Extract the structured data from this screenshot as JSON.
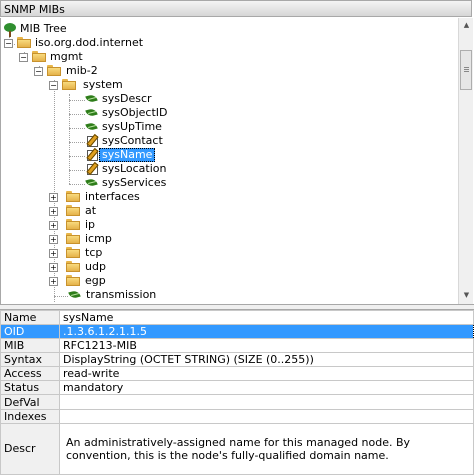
{
  "window": {
    "title": "SNMP MIBs"
  },
  "tree": {
    "root": "MIB Tree",
    "iso": "iso.org.dod.internet",
    "mgmt": "mgmt",
    "mib2": "mib-2",
    "system": "system",
    "system_children": [
      {
        "label": "sysDescr",
        "icon": "leaf-icon"
      },
      {
        "label": "sysObjectID",
        "icon": "leaf-icon"
      },
      {
        "label": "sysUpTime",
        "icon": "leaf-icon"
      },
      {
        "label": "sysContact",
        "icon": "writable-icon"
      },
      {
        "label": "sysName",
        "icon": "writable-icon",
        "selected": true
      },
      {
        "label": "sysLocation",
        "icon": "writable-icon"
      },
      {
        "label": "sysServices",
        "icon": "leaf-icon"
      }
    ],
    "mib2_folders": [
      "interfaces",
      "at",
      "ip",
      "icmp",
      "tcp",
      "udp",
      "egp"
    ],
    "transmission": "transmission"
  },
  "properties": {
    "header": {
      "name": "Name",
      "value": "sysName"
    },
    "rows": [
      {
        "key": "OID",
        "value": ".1.3.6.1.2.1.1.5",
        "selected": true
      },
      {
        "key": "MIB",
        "value": "RFC1213-MIB"
      },
      {
        "key": "Syntax",
        "value": "DisplayString (OCTET STRING) (SIZE (0..255))"
      },
      {
        "key": "Access",
        "value": "read-write"
      },
      {
        "key": "Status",
        "value": "mandatory"
      },
      {
        "key": "DefVal",
        "value": ""
      },
      {
        "key": "Indexes",
        "value": ""
      }
    ],
    "descr": {
      "key": "Descr",
      "value": "An administratively-assigned name for this managed node.  By convention, this is the node's fully-qualified domain name."
    }
  },
  "colors": {
    "selection": "#3399ff",
    "leaf": "#2e7d1a",
    "folder": "#f8db7e"
  }
}
